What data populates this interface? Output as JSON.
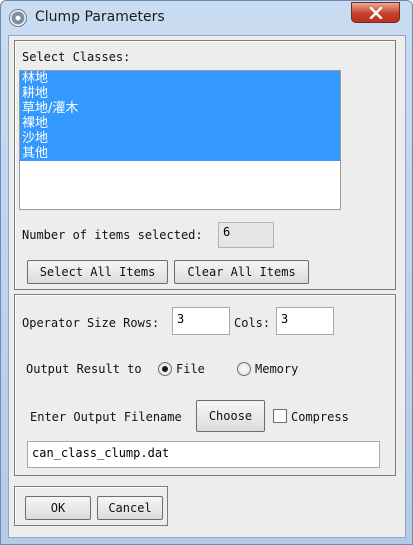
{
  "window": {
    "title": "Clump Parameters",
    "close_label": "×"
  },
  "select_classes": {
    "label": "Select Classes:",
    "items": [
      "林地",
      "耕地",
      "草地/灌木",
      "裸地",
      "沙地",
      "其他"
    ]
  },
  "selection": {
    "count_label": "Number of items selected:",
    "count_value": "6",
    "select_all_label": "Select All Items",
    "clear_all_label": "Clear All Items"
  },
  "operator": {
    "rows_label": "Operator Size Rows:",
    "rows_value": "3",
    "cols_label": "Cols:",
    "cols_value": "3"
  },
  "output": {
    "result_label": "Output Result to",
    "file_label": "File",
    "memory_label": "Memory",
    "selected": "File",
    "filename_label": "Enter Output Filename",
    "choose_label": "Choose",
    "compress_label": "Compress",
    "compress_checked": false,
    "filename_value": "can_class_clump.dat"
  },
  "footer": {
    "ok_label": "OK",
    "cancel_label": "Cancel"
  }
}
